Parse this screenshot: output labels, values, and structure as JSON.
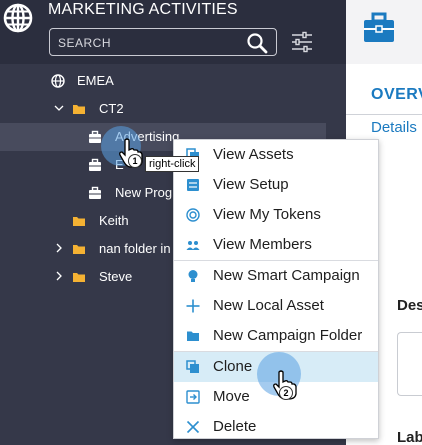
{
  "panel": {
    "title": "MARKETING ACTIVITIES",
    "search_placeholder": "SEARCH"
  },
  "tree": {
    "emea": "EMEA",
    "ct2": "CT2",
    "advertising": "Advertising",
    "e_program": "E",
    "new_program": "New Prog",
    "keith": "Keith",
    "nan_folder": "nan folder in",
    "steve": "Steve"
  },
  "right": {
    "overview_tab": "OVERV",
    "details_tab": "Details",
    "description_label": "Des",
    "labels_label": "Lab"
  },
  "menu": {
    "items": [
      {
        "label": "View Assets",
        "icon": "assets-icon"
      },
      {
        "label": "View Setup",
        "icon": "setup-icon"
      },
      {
        "label": "View My Tokens",
        "icon": "tokens-icon"
      },
      {
        "label": "View Members",
        "icon": "members-icon"
      },
      {
        "label": "New Smart Campaign",
        "icon": "smart-campaign-icon"
      },
      {
        "label": "New Local Asset",
        "icon": "plus-icon"
      },
      {
        "label": "New Campaign Folder",
        "icon": "folder-icon"
      },
      {
        "label": "Clone",
        "icon": "clone-icon"
      },
      {
        "label": "Move",
        "icon": "move-icon"
      },
      {
        "label": "Delete",
        "icon": "delete-icon"
      }
    ]
  },
  "annotations": {
    "step1": "1",
    "step2": "2",
    "right_click": "right-click"
  },
  "colors": {
    "panel_bg": "#353849",
    "header_bg": "#2b2e3e",
    "folder": "#f5b233",
    "accent_blue": "#1b7ac0",
    "menu_icon": "#2d8fcf",
    "highlight": "#d7ecf7"
  }
}
